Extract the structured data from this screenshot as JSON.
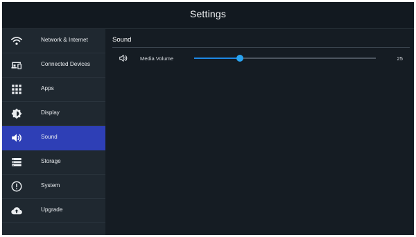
{
  "header": {
    "title": "Settings"
  },
  "sidebar": {
    "items": [
      {
        "label": "Network & Internet",
        "icon": "wifi-icon"
      },
      {
        "label": "Connected Devices",
        "icon": "connected-devices-icon"
      },
      {
        "label": "Apps",
        "icon": "apps-grid-icon"
      },
      {
        "label": "Display",
        "icon": "brightness-icon"
      },
      {
        "label": "Sound",
        "icon": "speaker-icon",
        "active": true
      },
      {
        "label": "Storage",
        "icon": "storage-icon"
      },
      {
        "label": "System",
        "icon": "info-icon"
      },
      {
        "label": "Upgrade",
        "icon": "cloud-upload-icon"
      }
    ]
  },
  "main": {
    "section_title": "Sound",
    "media_volume": {
      "label": "Media Volume",
      "value": "25",
      "level": 0.25
    }
  },
  "colors": {
    "background": "#151c23",
    "sidebar": "#1f2830",
    "active_item": "#2e3fb6",
    "slider_accent": "#29a3f0",
    "slider_track": "#4d5660"
  }
}
